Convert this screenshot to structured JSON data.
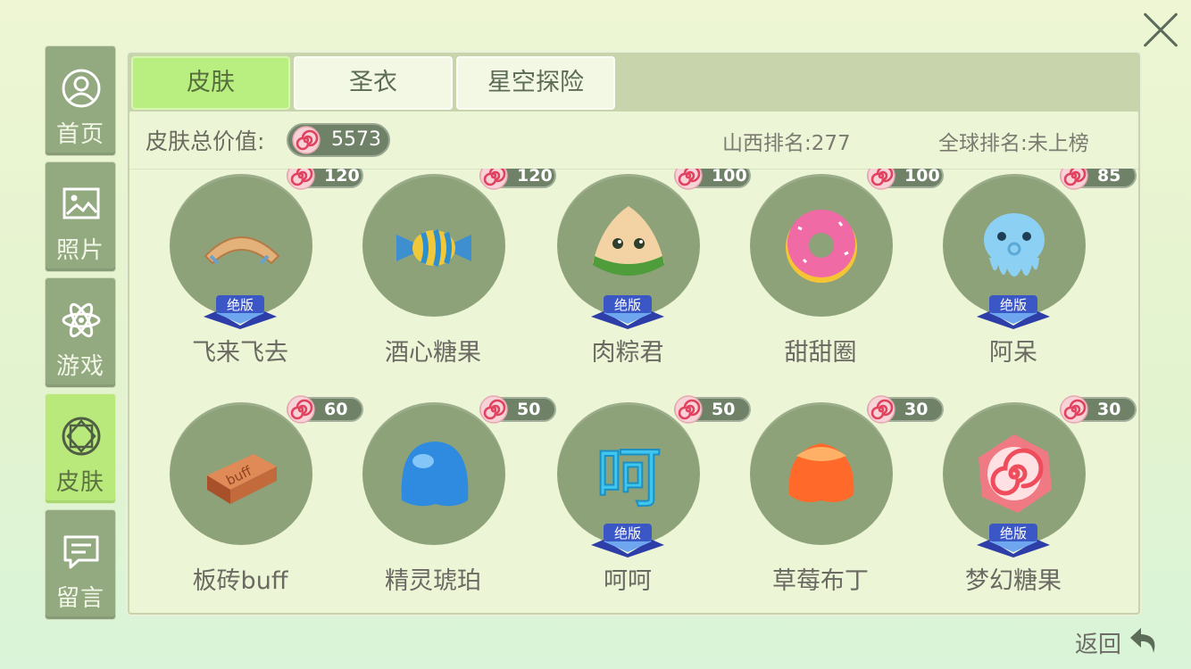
{
  "sidebar": {
    "items": [
      {
        "label": "首页",
        "icon": "user-icon"
      },
      {
        "label": "照片",
        "icon": "image-icon"
      },
      {
        "label": "游戏",
        "icon": "atom-icon"
      },
      {
        "label": "皮肤",
        "icon": "gem-icon",
        "active": true
      },
      {
        "label": "留言",
        "icon": "message-icon"
      }
    ]
  },
  "tabs": [
    {
      "label": "皮肤",
      "active": true
    },
    {
      "label": "圣衣"
    },
    {
      "label": "星空探险"
    }
  ],
  "summary": {
    "total_label": "皮肤总价值:",
    "total_value": "5573",
    "rank_region": "山西排名:277",
    "rank_global": "全球排名:未上榜"
  },
  "skins": [
    {
      "name": "飞来飞去",
      "price": "120",
      "limited": true,
      "art": "boomerang"
    },
    {
      "name": "酒心糖果",
      "price": "120",
      "limited": false,
      "art": "wrapped-candy"
    },
    {
      "name": "肉粽君",
      "price": "100",
      "limited": true,
      "art": "zongzi"
    },
    {
      "name": "甜甜圈",
      "price": "100",
      "limited": false,
      "art": "donut"
    },
    {
      "name": "阿呆",
      "price": "85",
      "limited": true,
      "art": "octopus"
    },
    {
      "name": "板砖buff",
      "price": "60",
      "limited": false,
      "art": "brick"
    },
    {
      "name": "精灵琥珀",
      "price": "50",
      "limited": false,
      "art": "blue-jelly"
    },
    {
      "name": "呵呵",
      "price": "50",
      "limited": true,
      "art": "hehe-text"
    },
    {
      "name": "草莓布丁",
      "price": "30",
      "limited": false,
      "art": "orange-jelly"
    },
    {
      "name": "梦幻糖果",
      "price": "30",
      "limited": true,
      "art": "swirl-candy"
    }
  ],
  "limited_badge_text": "绝版",
  "brick_text": "buff",
  "hehe_text": "呵",
  "back_label": "返回",
  "colors": {
    "active_green": "#b9ef81",
    "panel_bg": "#c7d4ac",
    "circle_bg": "#8ea27a",
    "pill_bg": "#6f8167"
  }
}
